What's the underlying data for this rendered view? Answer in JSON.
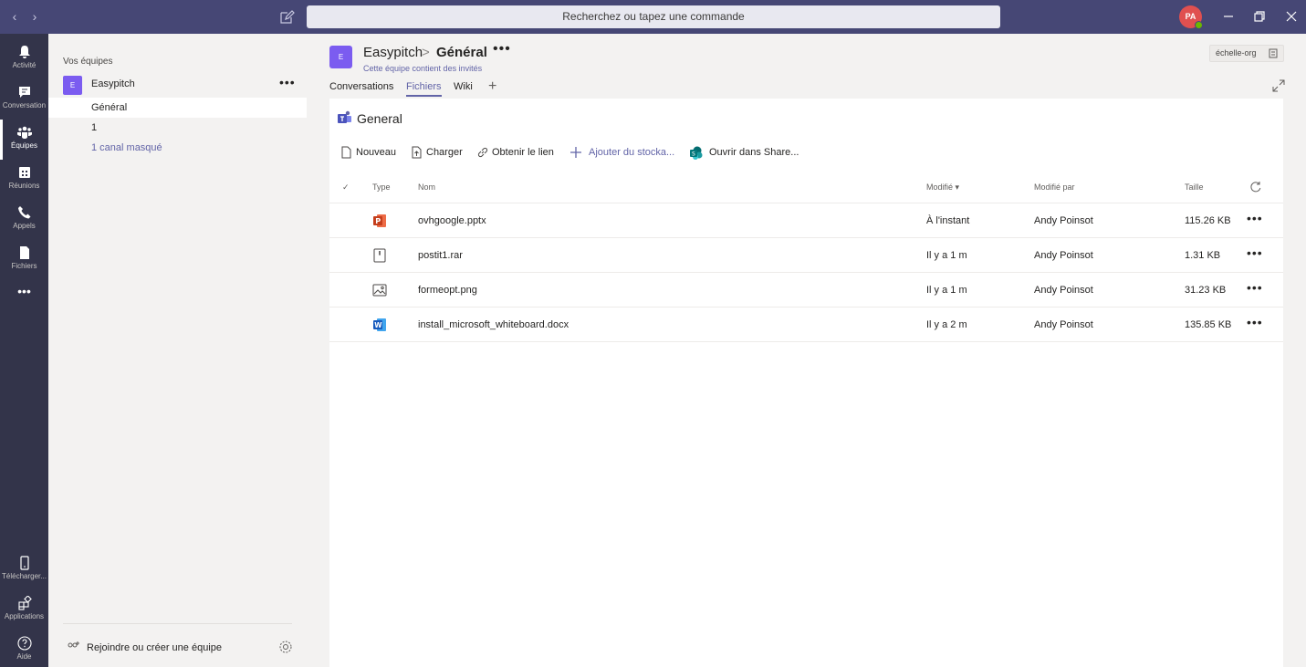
{
  "titlebar": {
    "back": "‹",
    "forward": "›",
    "search_placeholder": "Recherchez ou tapez une commande",
    "avatar_initials": "PA"
  },
  "appbar": {
    "items": [
      {
        "label": "Activité",
        "icon": "bell-icon"
      },
      {
        "label": "Conversation",
        "icon": "chat-icon"
      },
      {
        "label": "Équipes",
        "icon": "teams-icon"
      },
      {
        "label": "Réunions",
        "icon": "calendar-icon"
      },
      {
        "label": "Appels",
        "icon": "phone-icon"
      },
      {
        "label": "Fichiers",
        "icon": "file-icon"
      },
      {
        "label": "Télécharger...",
        "icon": "mobile-icon"
      },
      {
        "label": "Applications",
        "icon": "apps-icon"
      },
      {
        "label": "Aide",
        "icon": "help-icon"
      }
    ],
    "more": "•••"
  },
  "teams": {
    "header": "Vos équipes",
    "team": {
      "initial": "E",
      "name": "Easypitch",
      "more": "•••"
    },
    "channels": [
      {
        "label": "Général"
      },
      {
        "label": "1"
      },
      {
        "label": "1 canal masqué"
      }
    ],
    "join_label": "Rejoindre ou créer une équipe"
  },
  "channel": {
    "team_initial": "E",
    "team_name": "Easypitch",
    "separator": ">",
    "channel_name": "Général",
    "more": "•••",
    "subtitle": "Cette équipe contient des invités",
    "org_badge": "échelle-org",
    "tabs": [
      "Conversations",
      "Fichiers",
      "Wiki"
    ],
    "tab_add": "+"
  },
  "files": {
    "folder": "General",
    "commands": {
      "new": "Nouveau",
      "upload": "Charger",
      "get_link": "Obtenir le lien",
      "add_storage": "Ajouter du stocka...",
      "open_sharepoint": "Ouvrir dans Share..."
    },
    "columns": {
      "check": "✓",
      "type": "Type",
      "name": "Nom",
      "modified": "Modifié ▾",
      "modified_by": "Modifié par",
      "size": "Taille"
    },
    "rows": [
      {
        "name": "ovhgoogle.pptx",
        "modified": "À l'instant",
        "modified_by": "Andy Poinsot",
        "size": "115.26 KB",
        "icon": "powerpoint-icon",
        "more": "•••"
      },
      {
        "name": "postit1.rar",
        "modified": "Il y a 1 m",
        "modified_by": "Andy Poinsot",
        "size": "1.31 KB",
        "icon": "archive-icon",
        "more": "•••"
      },
      {
        "name": "formeopt.png",
        "modified": "Il y a 1 m",
        "modified_by": "Andy Poinsot",
        "size": "31.23 KB",
        "icon": "image-icon",
        "more": "•••"
      },
      {
        "name": "install_microsoft_whiteboard.docx",
        "modified": "Il y a 2 m",
        "modified_by": "Andy Poinsot",
        "size": "135.85 KB",
        "icon": "word-icon",
        "more": "•••"
      }
    ]
  },
  "colors": {
    "titlebar": "#464775",
    "appbar": "#33344a",
    "accent": "#6264a7",
    "team_tile": "#7b5cf0",
    "avatar": "#e05050",
    "presence": "#6bb700"
  }
}
